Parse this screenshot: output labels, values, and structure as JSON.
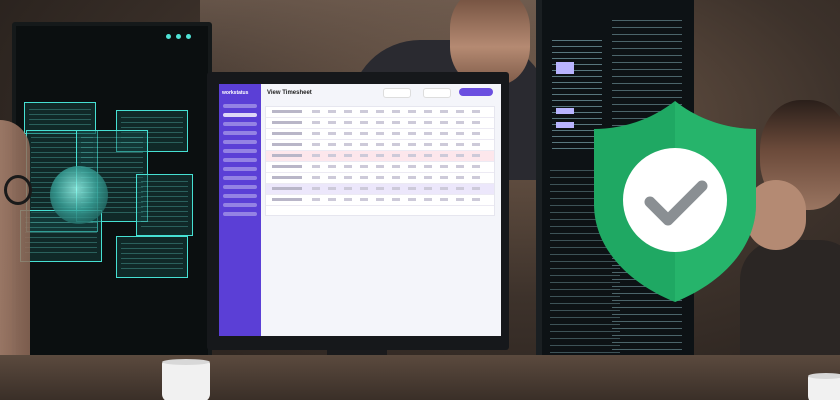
{
  "scene": {
    "shield_icon": "shield-check-icon",
    "shield_color": "#1fa863",
    "check_circle_color": "#ffffff",
    "check_color": "#8a8f93",
    "timesheet_app_accent": "#5b3fd6"
  },
  "timesheet_app": {
    "logo": "workstatus",
    "title": "View Timesheet"
  }
}
